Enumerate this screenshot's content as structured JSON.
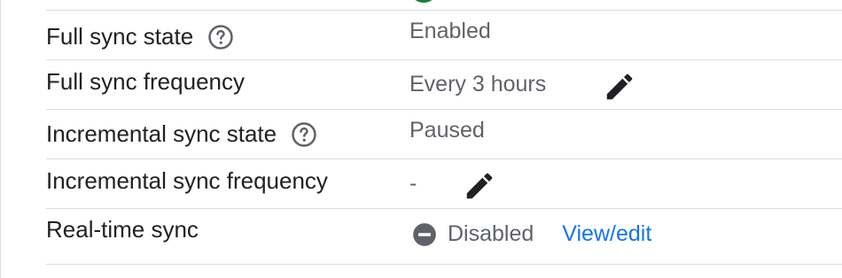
{
  "rows": [
    {
      "label": "Full sync state",
      "value": "Enabled"
    },
    {
      "label": "Full sync frequency",
      "value": "Every 3 hours"
    },
    {
      "label": "Incremental sync state",
      "value": "Paused"
    },
    {
      "label": "Incremental sync frequency",
      "value": "-"
    },
    {
      "label": "Real-time sync",
      "value": "Disabled",
      "link": "View/edit"
    }
  ],
  "icons": {
    "help": "help-circle-icon",
    "edit": "pencil-edit-icon",
    "disabled": "minus-circle-icon"
  },
  "colors": {
    "label_text": "#202124",
    "value_text": "#5f6368",
    "link": "#1a73e8",
    "divider": "#dadce0",
    "status_dot": "#188038",
    "icon_gray": "#5f6368",
    "edit_icon": "#202124"
  }
}
